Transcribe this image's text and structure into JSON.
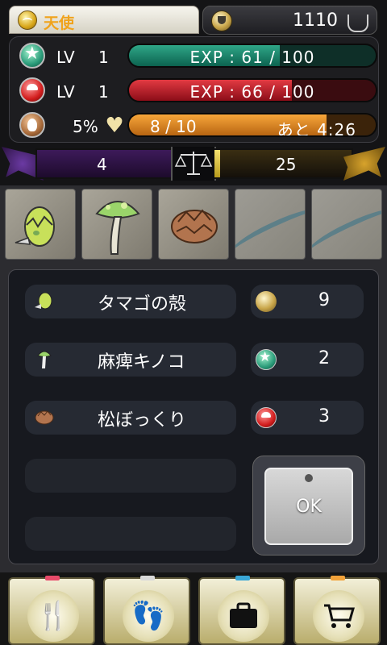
{
  "header": {
    "player_name": "天使",
    "coins": "1110",
    "stats": [
      {
        "level_label": "LV",
        "level": "1",
        "bar_text": "EXP : 61 / 100",
        "fill": 0.61,
        "color": "#2fa687"
      },
      {
        "level_label": "LV",
        "level": "1",
        "bar_text": "EXP : 66 / 100",
        "fill": 0.66,
        "color": "#e23a42"
      }
    ],
    "stamina": {
      "percent": "5%",
      "current": "8 / 10",
      "recover": "あと 4:26",
      "fill": 0.8
    },
    "balance": {
      "left": "4",
      "right": "25"
    }
  },
  "items": [
    {
      "name": "タマゴの殻",
      "icon": "eggshell-icon",
      "value": "9",
      "value_icon": "trophy-icon"
    },
    {
      "name": "麻痺キノコ",
      "icon": "mushroom-icon",
      "value": "2",
      "value_icon": "star-icon"
    },
    {
      "name": "松ぼっくり",
      "icon": "pinecone-icon",
      "value": "3",
      "value_icon": "mushroom-red-icon"
    }
  ],
  "ok_label": "OK",
  "nav": [
    {
      "icon": "fork-knife-icon",
      "tag": "#e84b6a"
    },
    {
      "icon": "footprints-icon",
      "tag": "#d9d9d9"
    },
    {
      "icon": "bag-icon",
      "tag": "#3aa7d6"
    },
    {
      "icon": "cart-icon",
      "tag": "#f2a23a"
    }
  ]
}
